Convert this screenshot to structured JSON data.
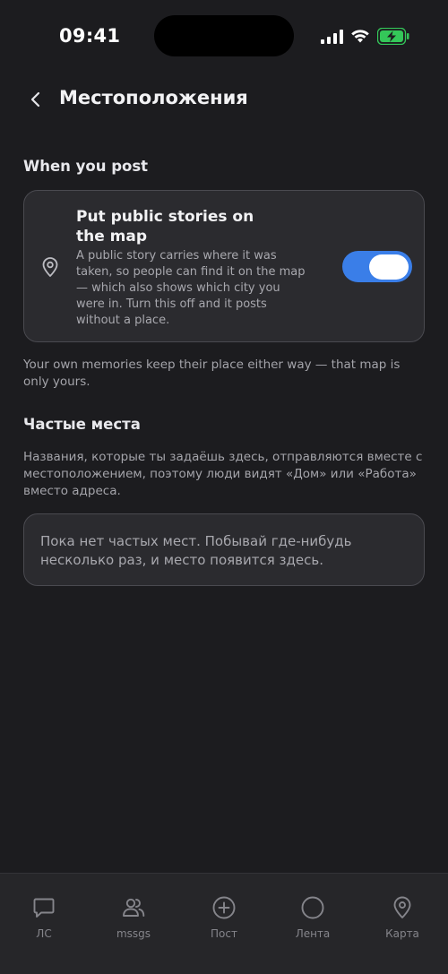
{
  "status_bar": {
    "time": "09:41",
    "icons": [
      "cellular-signal-icon",
      "wifi-icon",
      "battery-charging-icon"
    ],
    "battery_color": "#34c759"
  },
  "header": {
    "back_icon": "chevron-left-icon",
    "title": "Местоположения"
  },
  "when_you_post": {
    "section_title": "When you post",
    "toggle_card": {
      "icon": "map-pin-icon",
      "title": "Put public stories on the map",
      "description": "A public story carries where it was taken, so people can find it on the map — which also shows which city you were in. Turn this off and it posts without a place.",
      "toggle_on": true,
      "toggle_color": "#3a7ee8"
    },
    "hint": "Your own memories keep their place either way — that map is only yours."
  },
  "frequent_places": {
    "section_title": "Частые места",
    "description": "Названия, которые ты задаёшь здесь, отправляются вместе с местоположением, поэтому люди видят «Дом» или «Работа» вместо адреса.",
    "empty_state": "Пока нет частых мест. Побывай где-нибудь несколько раз, и место появится здесь."
  },
  "tab_bar": {
    "tabs": [
      {
        "label": "ЛС",
        "icon": "chat-bubble-icon"
      },
      {
        "label": "mssgs",
        "icon": "people-icon"
      },
      {
        "label": "Пост",
        "icon": "plus-circle-icon"
      },
      {
        "label": "Лента",
        "icon": "circle-ring-icon"
      },
      {
        "label": "Карта",
        "icon": "map-pin-icon"
      }
    ]
  }
}
